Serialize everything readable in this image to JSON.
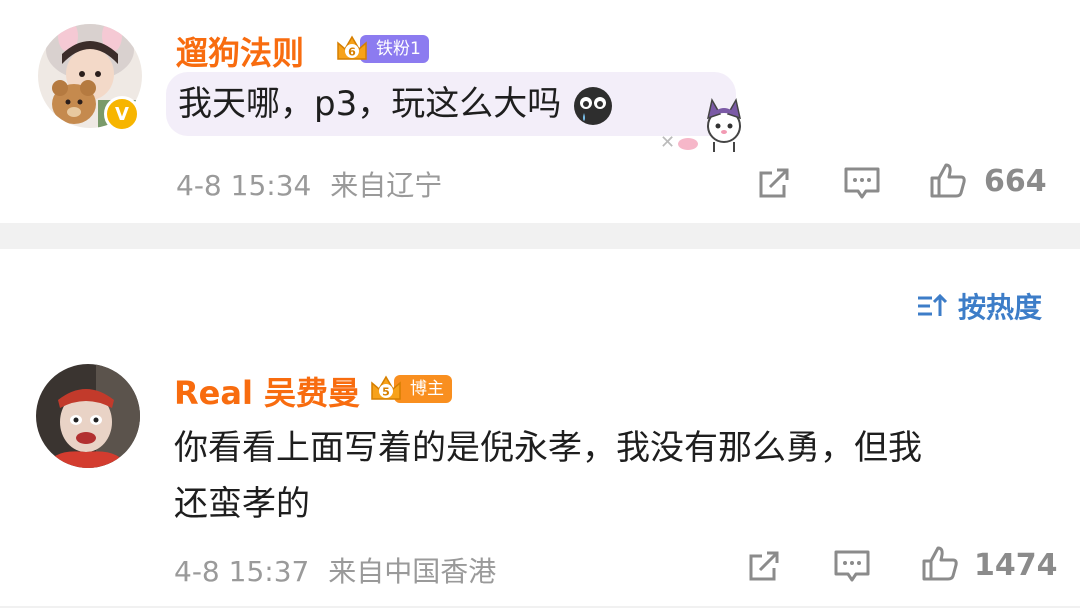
{
  "comment1": {
    "username": "遛狗法则",
    "fan_level": "6",
    "fan_label": "铁粉1",
    "text": "我天哪，p3，玩这么大吗",
    "emoji": "cry-face-icon",
    "time": "4-8 15:34",
    "location": "来自辽宁",
    "likes": "664",
    "verified_mark": "V"
  },
  "sort": {
    "label": "按热度"
  },
  "comment2": {
    "username": "Real 吴费曼",
    "fan_level": "5",
    "fan_label": "博主",
    "text_line1": "你看看上面写着的是倪永孝，我没有那么勇，但我",
    "text_line2": "还蛮孝的",
    "time": "4-8 15:37",
    "location": "来自中国香港",
    "likes": "1474"
  },
  "colors": {
    "username": "#f86c0f",
    "fan_badge_1": "#8c7bf0",
    "fan_badge_2": "#f98f1f",
    "sort_blue": "#3d7dc8",
    "meta_gray": "#9a9a9a"
  }
}
